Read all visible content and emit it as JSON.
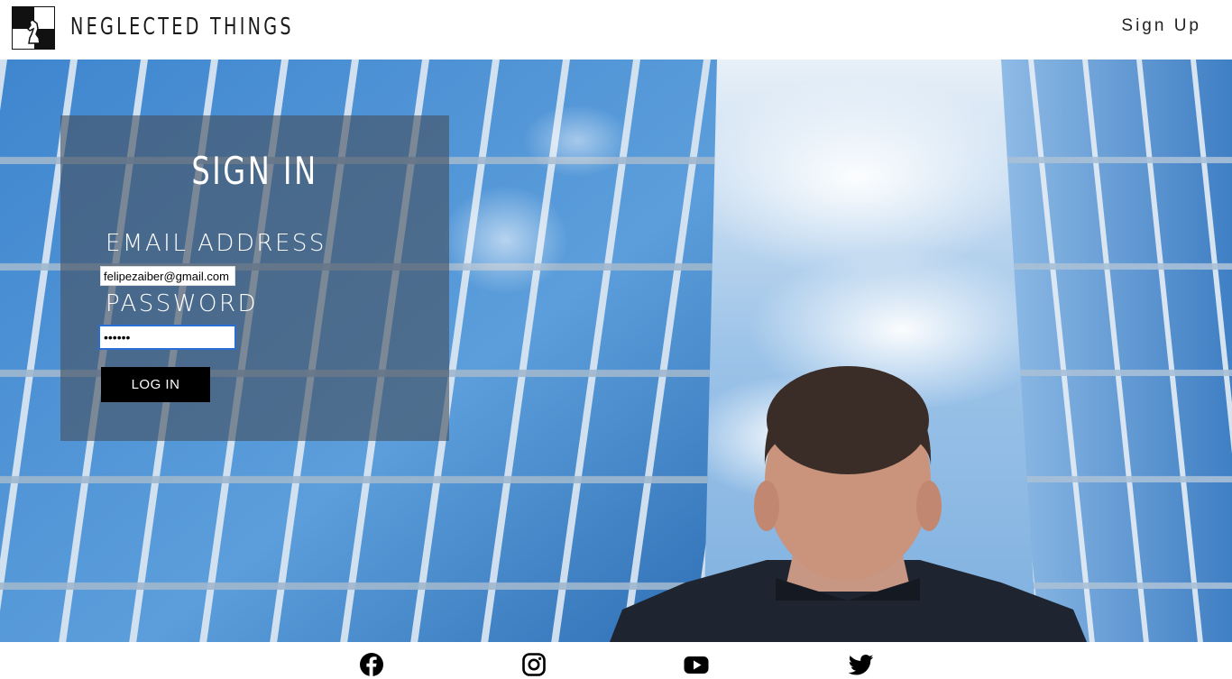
{
  "header": {
    "brand": "NEGLECTED THINGS",
    "signup_label": "Sign Up",
    "logo_icon": "chess-knight-logo-icon"
  },
  "signin": {
    "title": "SIGN IN",
    "email_label": "EMAIL ADDRESS",
    "email_value": "felipezaiber@gmail.com",
    "password_label": "PASSWORD",
    "password_value": "••••••",
    "login_label": "LOG IN"
  },
  "footer": {
    "social_icons": [
      "facebook-icon",
      "instagram-icon",
      "youtube-icon",
      "twitter-icon"
    ]
  },
  "colors": {
    "panel": "#46505f",
    "accent_focus": "#2a6fd6",
    "button": "#000000"
  }
}
